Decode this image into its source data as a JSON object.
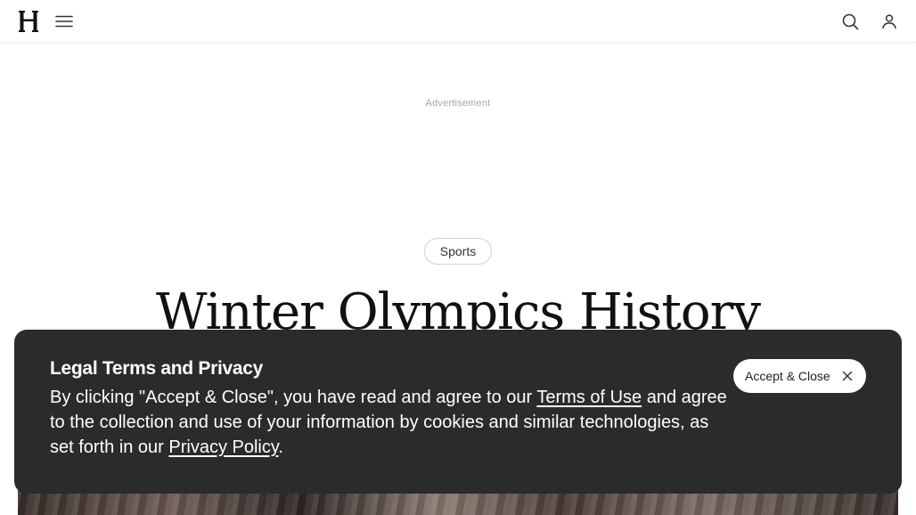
{
  "header": {
    "logo_letter": "H",
    "menu_icon": "hamburger-menu-icon",
    "search_icon": "search-icon",
    "account_icon": "user-account-icon"
  },
  "ad": {
    "label": "Advertisement"
  },
  "article": {
    "category": "Sports",
    "title": "Winter Olympics History"
  },
  "cookie_banner": {
    "title": "Legal Terms and Privacy",
    "text_before_terms": "By clicking \"Accept & Close\", you have read and agree to our ",
    "terms_link": "Terms of Use",
    "text_middle": " and agree to the collection and use of your information by cookies and similar technologies, as set forth in our ",
    "privacy_link": "Privacy Policy",
    "text_end": ".",
    "accept_label": "Accept & Close",
    "close_icon": "close-icon"
  },
  "colors": {
    "banner_bg": "#2b2b2b",
    "text": "#111111",
    "muted": "#a8a8a8"
  }
}
